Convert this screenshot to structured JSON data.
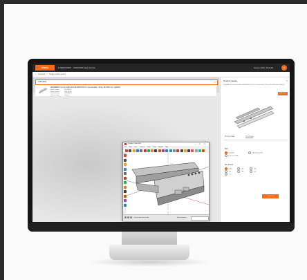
{
  "app": {
    "logo_text": "blum",
    "section": "E-SERVICES",
    "sep": ">",
    "title": "CAD/CAM Data Service",
    "user_text": "Hasan-Salim Bosnak",
    "avatar_text": "H"
  },
  "breadcrumb": {
    "home": "Overview",
    "sep": ">",
    "current": "Single product search"
  },
  "search": {
    "value": "756.5001S"
  },
  "product": {
    "title": "LEGRABOX runner profile and BLUMOTION S, full extension, 40 kg, NL=500 mm, right/left",
    "fields": [
      {
        "k": "Article number",
        "v": "756.5001S"
      },
      {
        "k": "Order number",
        "v": "Z30L3502A"
      },
      {
        "k": "Product family",
        "v": "LEGRABOX"
      },
      {
        "k": "Product range",
        "v": "Runners"
      }
    ]
  },
  "product_details": {
    "title": "Product details",
    "close": "×",
    "description": "LEGRABOX runner profile and BLUMOTION S, full extension, 40 kg, NL=500 mm, right/left",
    "add_button": "Add to list",
    "tabs": [
      "Product data",
      "Download"
    ],
    "active_tab": 1,
    "part_label": "Part",
    "part_options": [
      {
        "label": "Complete",
        "selected": true
      },
      {
        "label": "Individual profile",
        "selected": false
      },
      {
        "label": "Carcass profile",
        "selected": false
      }
    ],
    "format_label": "File format",
    "format_options": [
      {
        "label": "*.dwg",
        "selected": true
      },
      {
        "label": "*.dxf",
        "selected": false
      },
      {
        "label": "*.3ds",
        "selected": false
      },
      {
        "label": "*.igs",
        "selected": false
      },
      {
        "label": "*.skp",
        "selected": false
      },
      {
        "label": "*.stp",
        "selected": false
      },
      {
        "label": "*.x_t",
        "selected": false
      }
    ],
    "download_button": "Download"
  },
  "footer": {
    "text": "Legal notes · Privacy policy · Imprint"
  },
  "sketchup": {
    "title": "Untitled - SketchUp",
    "menus": [
      "File",
      "Edit",
      "View",
      "Camera",
      "Draw",
      "Tools",
      "Window",
      "Help"
    ],
    "status": "Drag in direction to orbit.",
    "measurements_label": "Measurements",
    "window_controls": [
      "–",
      "□",
      "×"
    ],
    "tool_colors": [
      "#e23b3b",
      "#4a4a4a",
      "#f0a020",
      "#2e7dd1",
      "#6b6b6b",
      "#c0392b",
      "#27ae60",
      "#e67e22",
      "#3a3a3a",
      "#d35400",
      "#8e44ad",
      "#2980b9",
      "#16a085",
      "#7f8c8d",
      "#c0392b",
      "#34495e",
      "#f39c12",
      "#2c3e50",
      "#e74c3c",
      "#95a5a6",
      "#1abc9c",
      "#d35400"
    ]
  },
  "colors": {
    "brand": "#f26a1b",
    "topbar": "#262626"
  }
}
